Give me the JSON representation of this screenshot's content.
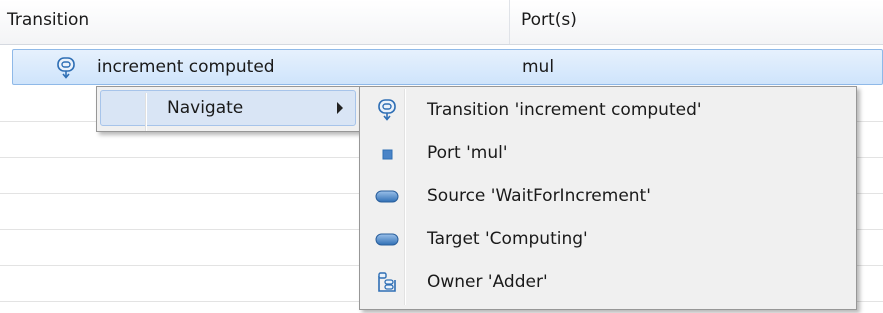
{
  "table": {
    "columns": [
      "Transition",
      "Port(s)"
    ],
    "selected_row": {
      "transition": "increment computed",
      "port": "mul"
    },
    "empty_rows": 6
  },
  "context_menu": {
    "navigate_label": "Navigate"
  },
  "submenu": {
    "items": [
      {
        "label": "Transition 'increment computed'",
        "icon": "transition-icon"
      },
      {
        "label": "Port 'mul'",
        "icon": "port-icon"
      },
      {
        "label": "Source 'WaitForIncrement'",
        "icon": "state-icon"
      },
      {
        "label": "Target 'Computing'",
        "icon": "state-icon"
      },
      {
        "label": "Owner 'Adder'",
        "icon": "owner-icon"
      }
    ]
  },
  "colors": {
    "selection": "#cfe4fb",
    "menu_background": "#f0f0f0",
    "icon_blue": "#2f6fb5"
  }
}
